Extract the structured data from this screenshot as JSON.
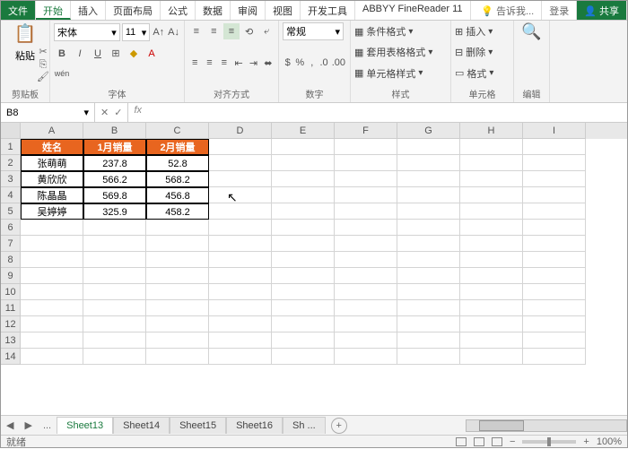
{
  "tabs": {
    "file": "文件",
    "list": [
      "开始",
      "插入",
      "页面布局",
      "公式",
      "数据",
      "审阅",
      "视图",
      "开发工具",
      "ABBYY FineReader 11"
    ],
    "active": 0,
    "tell": "告诉我...",
    "login": "登录",
    "share": "共享"
  },
  "ribbon": {
    "clipboard": {
      "paste": "粘贴",
      "label": "剪贴板"
    },
    "font": {
      "name": "宋体",
      "size": "11",
      "label": "字体"
    },
    "align": {
      "label": "对齐方式"
    },
    "number": {
      "format": "常规",
      "label": "数字"
    },
    "styles": {
      "cond": "条件格式",
      "tbl": "套用表格格式",
      "cell": "单元格样式",
      "label": "样式"
    },
    "cells": {
      "ins": "插入",
      "del": "删除",
      "fmt": "格式",
      "label": "单元格"
    },
    "edit": {
      "label": "编辑"
    }
  },
  "namebox": "B8",
  "chart_data": {
    "type": "table",
    "columns": [
      "姓名",
      "1月销量",
      "2月销量"
    ],
    "rows": [
      [
        "张萌萌",
        237.8,
        52.8
      ],
      [
        "黄欣欣",
        566.2,
        568.2
      ],
      [
        "陈晶晶",
        569.8,
        456.8
      ],
      [
        "吴婷婷",
        325.9,
        458.2
      ]
    ]
  },
  "gridCols": [
    "A",
    "B",
    "C",
    "D",
    "E",
    "F",
    "G",
    "H",
    "I"
  ],
  "gridRows": 14,
  "sheets": {
    "list": [
      "Sheet13",
      "Sheet14",
      "Sheet15",
      "Sheet16",
      "Sh ..."
    ],
    "active": 0,
    "ellipsis": "..."
  },
  "status": {
    "ready": "就绪",
    "zoom": "100%"
  }
}
